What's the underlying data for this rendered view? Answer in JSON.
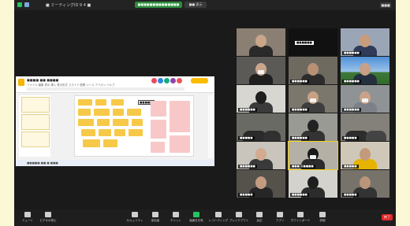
{
  "window": {
    "meeting_title": "■ ミーティングID 9 4 ■",
    "recording_label": "■■■■■■■■■■■■■■",
    "view_label": "■■ 表示",
    "layout_label": "■■■"
  },
  "shared_screen": {
    "doc_title": "■■■■ ■■ ■■■■",
    "menu_text": "ファイル 編集 表示 挿入 表示形式 スライド 配置 ツール アドオン ヘルプ",
    "note_label": "■■■■■",
    "status_text": "■■■■■ ■■ ■ ■■■"
  },
  "participants": [
    {
      "name": ""
    },
    {
      "name": "■■■■■■"
    },
    {
      "name": "■■■■■■"
    },
    {
      "name": ""
    },
    {
      "name": "■■■■■■"
    },
    {
      "name": "■■■■■■"
    },
    {
      "name": "■■■■■■"
    },
    {
      "name": "■■■■■■"
    },
    {
      "name": "■■■■■■"
    },
    {
      "name": "■■■■■"
    },
    {
      "name": "■■■■■■"
    },
    {
      "name": "■■■■■"
    },
    {
      "name": "■■■■■■"
    },
    {
      "name": "■■■ 高■■■■"
    },
    {
      "name": "■■■■■"
    },
    {
      "name": "■■■■■"
    },
    {
      "name": "■■■■■■"
    },
    {
      "name": "■■■■■"
    }
  ],
  "toolbar": {
    "mute": "ミュート",
    "video": "ビデオの停止",
    "security": "セキュリティ",
    "participants": "参加者",
    "chat": "チャット",
    "share": "画面を共有",
    "record": "レコーディング",
    "breakout": "ブレイクアウト",
    "reactions": "反応",
    "apps": "アプリ",
    "whiteboard": "ホワイトボード",
    "more": "詳細",
    "end": "終了"
  },
  "colors": {
    "accent_green": "#23c55e",
    "end_red": "#e02828",
    "sticky_yellow": "#f7c948",
    "sticky_pink": "#f8c8c8"
  }
}
